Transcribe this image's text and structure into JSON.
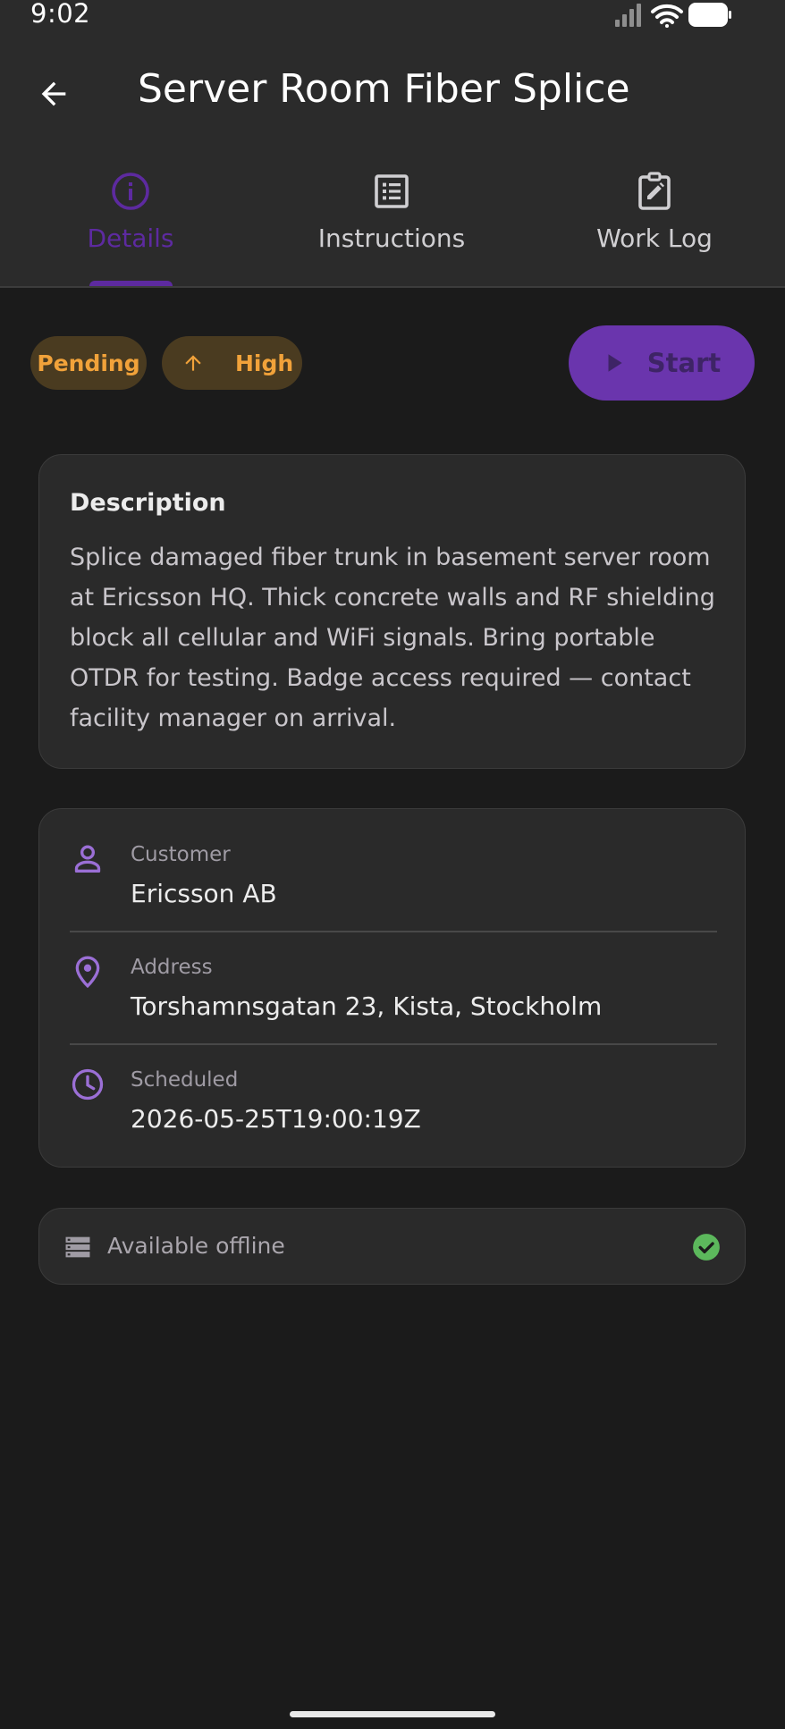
{
  "status_bar": {
    "time": "9:02"
  },
  "app_bar": {
    "title": "Server Room Fiber Splice"
  },
  "tabs": [
    {
      "label": "Details",
      "icon": "info-icon",
      "active": true
    },
    {
      "label": "Instructions",
      "icon": "list-icon",
      "active": false
    },
    {
      "label": "Work Log",
      "icon": "clipboard-edit-icon",
      "active": false
    }
  ],
  "chips": {
    "status": "Pending",
    "priority": "High"
  },
  "actions": {
    "start_label": "Start"
  },
  "description": {
    "title": "Description",
    "body": "Splice damaged fiber trunk in basement server room at Ericsson HQ. Thick concrete walls and RF shielding block all cellular and WiFi signals. Bring portable OTDR for testing. Badge access required — contact facility manager on arrival."
  },
  "info": [
    {
      "label": "Customer",
      "value": "Ericsson AB",
      "icon": "person-icon"
    },
    {
      "label": "Address",
      "value": "Torshamnsgatan 23, Kista, Stockholm",
      "icon": "location-pin-icon"
    },
    {
      "label": "Scheduled",
      "value": "2026-05-25T19:00:19Z",
      "icon": "clock-icon"
    }
  ],
  "offline": {
    "label": "Available offline",
    "icon": "storage-icon",
    "status_icon": "check-circle-icon"
  },
  "colors": {
    "accent": "#5d2aa0",
    "icon_accent": "#9b6fd6",
    "chip_text": "#f1a23a",
    "chip_bg": "#4a3b20",
    "success": "#5cb85c",
    "background": "#1b1b1b",
    "surface": "#2a2a2a"
  }
}
